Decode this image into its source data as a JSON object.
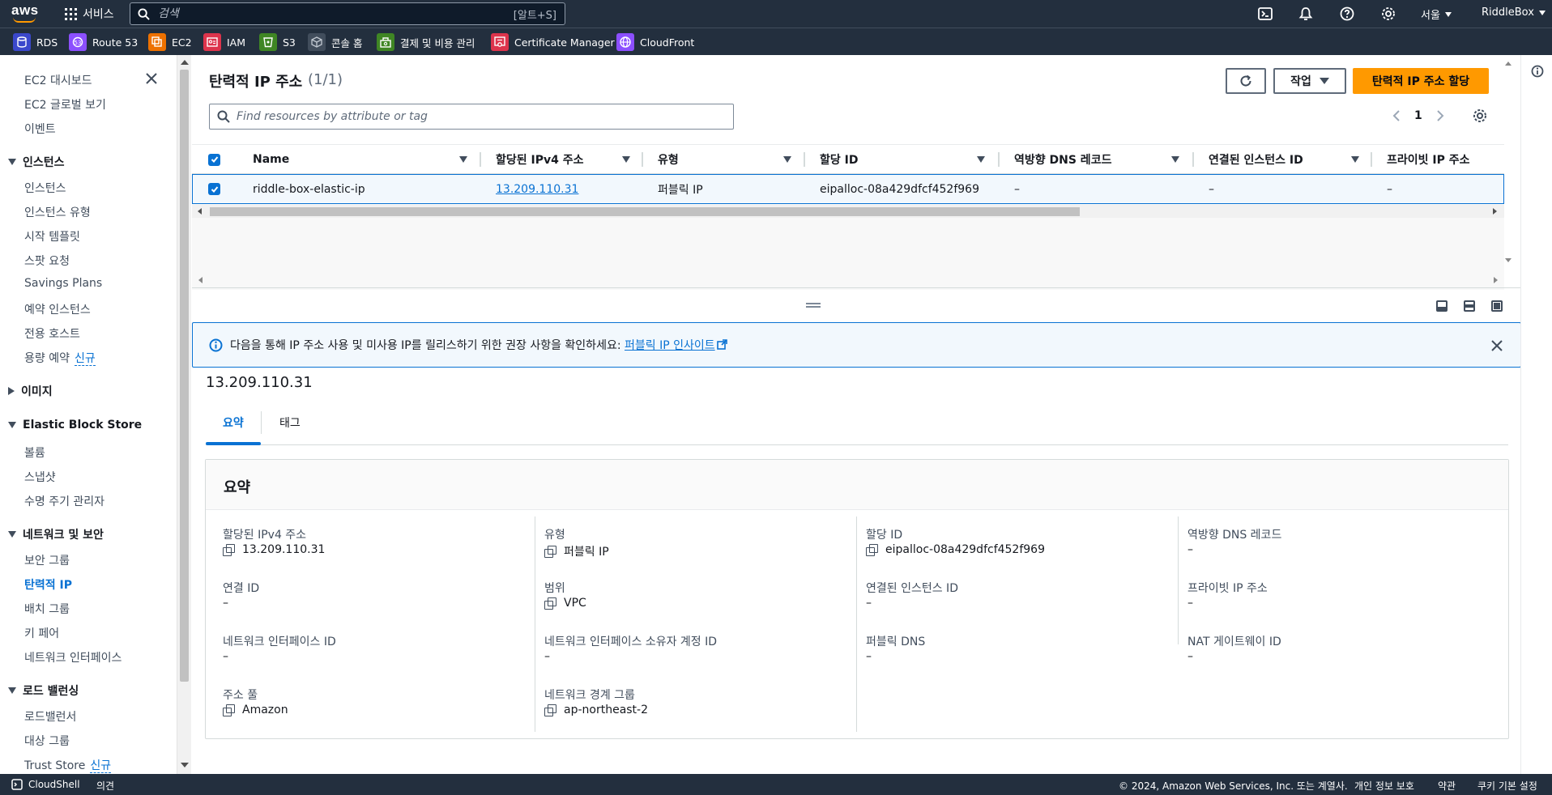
{
  "topnav": {
    "services_label": "서비스",
    "search_placeholder": "검색",
    "search_shortcut": "[알트+S]",
    "region_label": "서울",
    "account_label": "RiddleBox"
  },
  "favorites": [
    {
      "label": "RDS",
      "icon": "rds-icon",
      "color": "#3b48cc"
    },
    {
      "label": "Route 53",
      "icon": "route53-icon",
      "color": "#8c4fff"
    },
    {
      "label": "EC2",
      "icon": "ec2-icon",
      "color": "#ed7100"
    },
    {
      "label": "IAM",
      "icon": "iam-icon",
      "color": "#dd344c"
    },
    {
      "label": "S3",
      "icon": "s3-icon",
      "color": "#3f8624"
    },
    {
      "label": "콘솔 홈",
      "icon": "console-home-icon",
      "color": "#414d5c"
    },
    {
      "label": "결제 및 비용 관리",
      "icon": "billing-icon",
      "color": "#3f8624"
    },
    {
      "label": "Certificate Manager",
      "icon": "certificate-icon",
      "color": "#dd344c"
    },
    {
      "label": "CloudFront",
      "icon": "cloudfront-icon",
      "color": "#8c4fff"
    }
  ],
  "sidebar": {
    "top_items": [
      "EC2 대시보드",
      "EC2 글로벌 보기",
      "이벤트"
    ],
    "sections": [
      {
        "title": "인스턴스",
        "expanded": true,
        "items": [
          "인스턴스",
          "인스턴스 유형",
          "시작 템플릿",
          "스팟 요청",
          "Savings Plans",
          "예약 인스턴스",
          "전용 호스트",
          "용량 예약"
        ]
      },
      {
        "title": "이미지",
        "expanded": false,
        "items": []
      },
      {
        "title": "Elastic Block Store",
        "expanded": true,
        "items": [
          "볼륨",
          "스냅샷",
          "수명 주기 관리자"
        ]
      },
      {
        "title": "네트워크 및 보안",
        "expanded": true,
        "items": [
          "보안 그룹",
          "탄력적 IP",
          "배치 그룹",
          "키 페어",
          "네트워크 인터페이스"
        ]
      },
      {
        "title": "로드 밸런싱",
        "expanded": true,
        "items": [
          "로드밸런서",
          "대상 그룹",
          "Trust Store"
        ]
      }
    ],
    "new_badge": "신규",
    "active_item": "탄력적 IP"
  },
  "panel": {
    "title": "탄력적 IP 주소",
    "count": "(1/1)",
    "actions_label": "작업",
    "allocate_label": "탄력적 IP 주소 할당",
    "filter_placeholder": "Find resources by attribute or tag",
    "page": "1"
  },
  "table": {
    "columns": [
      "Name",
      "할당된 IPv4 주소",
      "유형",
      "할당 ID",
      "역방향 DNS 레코드",
      "연결된 인스턴스 ID",
      "프라이빗 IP 주소"
    ],
    "rows": [
      [
        "riddle-box-elastic-ip",
        "13.209.110.31",
        "퍼블릭 IP",
        "eipalloc-08a429dfcf452f969",
        "–",
        "–",
        "–"
      ]
    ]
  },
  "banner": {
    "message": "다음을 통해 IP 주소 사용 및 미사용 IP를 릴리스하기 위한 권장 사항을 확인하세요: ",
    "link": "퍼블릭 IP 인사이트"
  },
  "detail": {
    "title": "13.209.110.31",
    "tabs": [
      "요약",
      "태그"
    ],
    "summary_title": "요약",
    "fields": [
      {
        "label": "할당된 IPv4 주소",
        "value": "13.209.110.31",
        "copy": true
      },
      {
        "label": "유형",
        "value": "퍼블릭 IP",
        "copy": true
      },
      {
        "label": "할당 ID",
        "value": "eipalloc-08a429dfcf452f969",
        "copy": true
      },
      {
        "label": "역방향 DNS 레코드",
        "value": "–",
        "copy": false
      },
      {
        "label": "연결 ID",
        "value": "–",
        "copy": false
      },
      {
        "label": "범위",
        "value": "VPC",
        "copy": true
      },
      {
        "label": "연결된 인스턴스 ID",
        "value": "–",
        "copy": false
      },
      {
        "label": "프라이빗 IP 주소",
        "value": "–",
        "copy": false
      },
      {
        "label": "네트워크 인터페이스 ID",
        "value": "–",
        "copy": false
      },
      {
        "label": "네트워크 인터페이스 소유자 계정 ID",
        "value": "–",
        "copy": false
      },
      {
        "label": "퍼블릭 DNS",
        "value": "–",
        "copy": false
      },
      {
        "label": "NAT 게이트웨이 ID",
        "value": "–",
        "copy": false
      },
      {
        "label": "주소 풀",
        "value": "Amazon",
        "copy": true
      },
      {
        "label": "네트워크 경계 그룹",
        "value": "ap-northeast-2",
        "copy": true
      }
    ]
  },
  "footer": {
    "cloudshell": "CloudShell",
    "feedback": "의견",
    "copyright": "© 2024, Amazon Web Services, Inc. 또는 계열사.",
    "privacy": "개인 정보 보호",
    "terms": "약관",
    "cookies": "쿠키 기본 설정"
  }
}
